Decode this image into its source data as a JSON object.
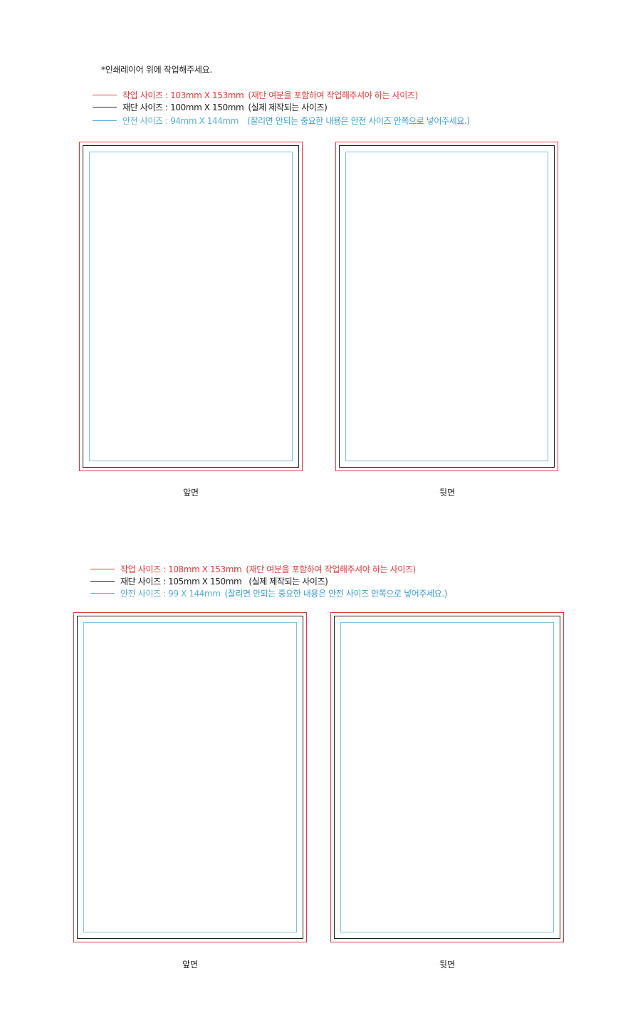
{
  "note": "*인쇄레이어 위에 작업해주세요.",
  "colors": {
    "work": "#e03a3a",
    "cut": "#222222",
    "safe": "#5aaed8"
  },
  "sections": [
    {
      "legend": [
        {
          "label": "작업 사이즈 : 103mm X 153mm",
          "desc": "(재단 여분을 포함하여 작업해주셔야 하는 사이즈)"
        },
        {
          "label": "재단 사이즈 : 100mm X 150mm",
          "desc": "(실제 제작되는 사이즈)"
        },
        {
          "label": "안전 사이즈 :  94mm X 144mm",
          "desc": "(잘리면 안되는 중요한 내용은 안전 사이즈 안쪽으로 넣어주세요.)"
        }
      ],
      "front_label": "앞면",
      "back_label": "뒷면"
    },
    {
      "legend": [
        {
          "label": "작업 사이즈 : 108mm X 153mm",
          "desc": "(재단 여분을 포함하여 작업해주셔야 하는 사이즈)"
        },
        {
          "label": "재단 사이즈 : 105mm X 150mm",
          "desc": "(실제 제작되는 사이즈)"
        },
        {
          "label": "안전 사이즈 : 99 X 144mm",
          "desc": "(잘리면 안되는 중요한 내용은 안전 사이즈 안쪽으로 넣어주세요.)"
        }
      ],
      "front_label": "앞면",
      "back_label": "뒷면"
    }
  ]
}
